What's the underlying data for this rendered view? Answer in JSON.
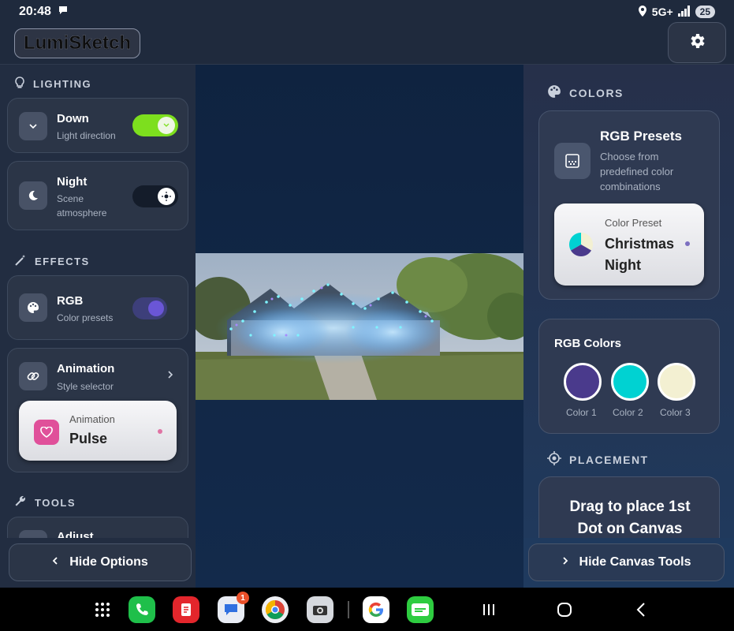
{
  "status_bar": {
    "time": "20:48",
    "network": "5G+",
    "battery": "25"
  },
  "app": {
    "logo_text": "LumiSketch"
  },
  "left_panel": {
    "lighting": {
      "header": "LIGHTING",
      "direction": {
        "title": "Down",
        "subtitle": "Light direction",
        "enabled": true
      },
      "scene": {
        "title": "Night",
        "subtitle_line1": "Scene",
        "subtitle_line2": "atmosphere",
        "enabled": true
      }
    },
    "effects": {
      "header": "EFFECTS",
      "rgb": {
        "title": "RGB",
        "subtitle": "Color presets",
        "enabled": true
      },
      "animation": {
        "title": "Animation",
        "subtitle": "Style selector",
        "picker_label": "Animation",
        "picker_value": "Pulse"
      }
    },
    "tools": {
      "header": "TOOLS",
      "adjust_title": "Adjust"
    },
    "hide_button": "Hide Options"
  },
  "right_panel": {
    "colors_header": "COLORS",
    "rgb_presets": {
      "title": "RGB Presets",
      "desc_line1": "Choose from",
      "desc_line2": "predefined color",
      "desc_line3": "combinations",
      "picker_label": "Color Preset",
      "picker_value_line1": "Christmas",
      "picker_value_line2": "Night"
    },
    "rgb_colors": {
      "title": "RGB Colors",
      "swatches": [
        {
          "label": "Color 1",
          "color": "#4a3a8c"
        },
        {
          "label": "Color 2",
          "color": "#00d2d2"
        },
        {
          "label": "Color 3",
          "color": "#f3f0d2"
        }
      ]
    },
    "placement": {
      "header": "PLACEMENT",
      "instruction_line1": "Drag to place 1st",
      "instruction_line2": "Dot on Canvas"
    },
    "hide_button": "Hide Canvas Tools"
  },
  "nav_bar": {
    "messages_badge": "1"
  },
  "colors": {
    "toggle_green": "#7ddf1e",
    "toggle_purple": "#6a56d6",
    "accent_pink": "#e0509a"
  }
}
